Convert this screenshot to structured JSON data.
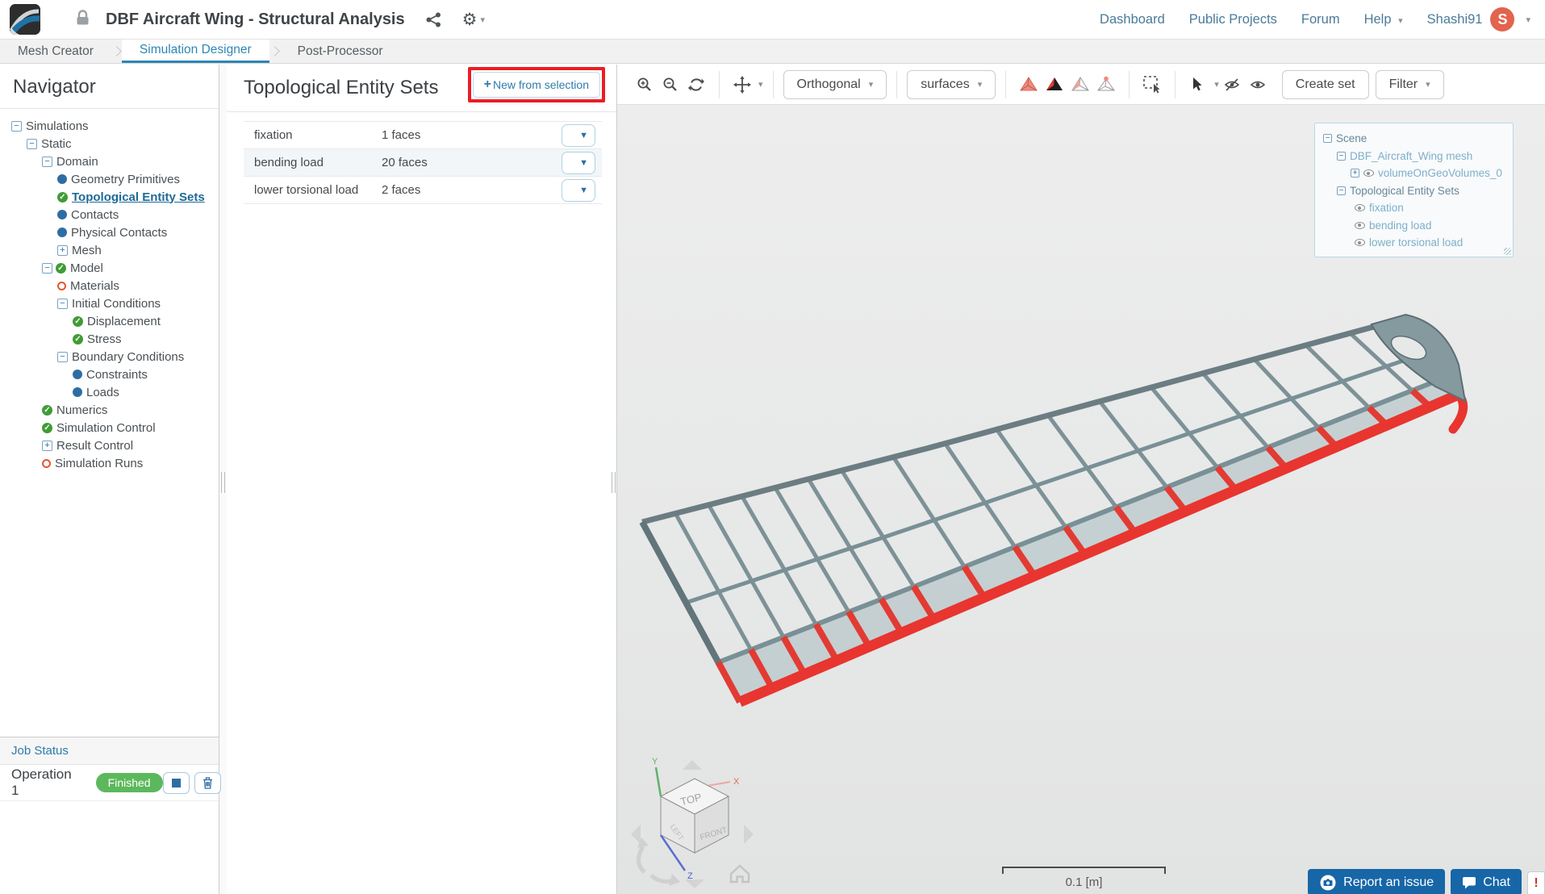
{
  "header": {
    "title": "DBF Aircraft Wing - Structural Analysis",
    "nav_items": [
      "Dashboard",
      "Public Projects",
      "Forum"
    ],
    "help_label": "Help",
    "username": "Shashi91",
    "avatar_initial": "S"
  },
  "tabs": {
    "items": [
      {
        "label": "Mesh Creator",
        "active": false
      },
      {
        "label": "Simulation Designer",
        "active": true
      },
      {
        "label": "Post-Processor",
        "active": false
      }
    ]
  },
  "navigator": {
    "title": "Navigator",
    "items": [
      {
        "label": "Simulations",
        "icon": "minus",
        "indent": 0
      },
      {
        "label": "Static",
        "icon": "minus",
        "indent": 1
      },
      {
        "label": "Domain",
        "icon": "minus",
        "indent": 2
      },
      {
        "label": "Geometry Primitives",
        "icon": "dot",
        "indent": 3
      },
      {
        "label": "Topological Entity Sets",
        "icon": "check",
        "indent": 3,
        "selected": true
      },
      {
        "label": "Contacts",
        "icon": "dot",
        "indent": 3
      },
      {
        "label": "Physical Contacts",
        "icon": "dot",
        "indent": 3
      },
      {
        "label": "Mesh",
        "icon": "plus",
        "indent": 3
      },
      {
        "label": "Model",
        "icon": "minus-check",
        "indent": 2
      },
      {
        "label": "Materials",
        "icon": "ring",
        "indent": 3
      },
      {
        "label": "Initial Conditions",
        "icon": "minus",
        "indent": 3
      },
      {
        "label": "Displacement",
        "icon": "check",
        "indent": 4
      },
      {
        "label": "Stress",
        "icon": "check",
        "indent": 4
      },
      {
        "label": "Boundary Conditions",
        "icon": "minus",
        "indent": 3
      },
      {
        "label": "Constraints",
        "icon": "dot",
        "indent": 4
      },
      {
        "label": "Loads",
        "icon": "dot",
        "indent": 4
      },
      {
        "label": "Numerics",
        "icon": "check",
        "indent": 2
      },
      {
        "label": "Simulation Control",
        "icon": "check",
        "indent": 2
      },
      {
        "label": "Result Control",
        "icon": "plus",
        "indent": 2
      },
      {
        "label": "Simulation Runs",
        "icon": "ring",
        "indent": 2
      }
    ]
  },
  "entity_sets": {
    "title": "Topological Entity Sets",
    "new_button_label": "New from selection",
    "rows": [
      {
        "name": "fixation",
        "faces": "1 faces"
      },
      {
        "name": "bending load",
        "faces": "20 faces"
      },
      {
        "name": "lower torsional load",
        "faces": "2 faces"
      }
    ]
  },
  "viewport_toolbar": {
    "projection": "Orthogonal",
    "render_mode": "surfaces",
    "create_set": "Create set",
    "filter": "Filter"
  },
  "scene_tree": {
    "items": [
      {
        "label": "Scene",
        "toggle": "minus",
        "eye": false,
        "indent": 0,
        "tone": "group"
      },
      {
        "label": "DBF_Aircraft_Wing mesh",
        "toggle": "minus",
        "eye": false,
        "indent": 1,
        "tone": "item"
      },
      {
        "label": "volumeOnGeoVolumes_0",
        "toggle": "plus",
        "eye": true,
        "indent": 2,
        "tone": "item"
      },
      {
        "label": "Topological Entity Sets",
        "toggle": "minus",
        "eye": false,
        "indent": 1,
        "tone": "group"
      },
      {
        "label": "fixation",
        "toggle": null,
        "eye": true,
        "indent": 2,
        "tone": "item"
      },
      {
        "label": "bending load",
        "toggle": null,
        "eye": true,
        "indent": 2,
        "tone": "item"
      },
      {
        "label": "lower torsional load",
        "toggle": null,
        "eye": true,
        "indent": 2,
        "tone": "item"
      }
    ]
  },
  "view_cube": {
    "top": "TOP",
    "front": "FRONT",
    "left": "LEFT",
    "axis_x": "X",
    "axis_y": "Y",
    "axis_z": "Z"
  },
  "scale_bar": {
    "label": "0.1 [m]"
  },
  "job_status": {
    "title": "Job Status",
    "job_name": "Operation 1",
    "status": "Finished"
  },
  "support": {
    "report": "Report an issue",
    "chat": "Chat",
    "alert": "!"
  },
  "colors": {
    "accent": "#2e86b5",
    "selection_red": "#e8352f",
    "finished_green": "#5cb85c",
    "annotation_red": "#ec1c24"
  }
}
